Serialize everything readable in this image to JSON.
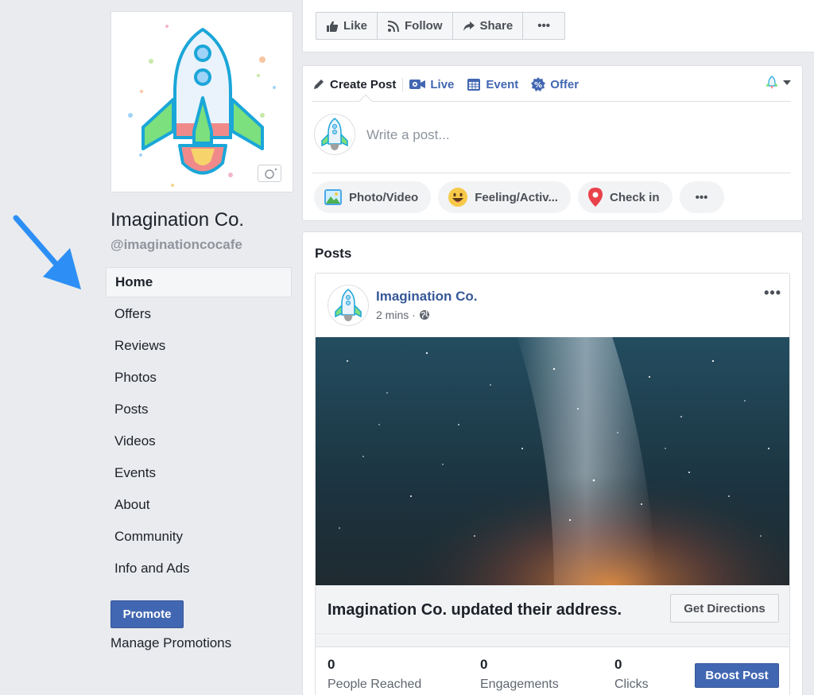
{
  "page": {
    "name": "Imagination Co.",
    "handle": "@imaginationcocafe"
  },
  "nav": {
    "items": [
      {
        "label": "Home"
      },
      {
        "label": "Offers"
      },
      {
        "label": "Reviews"
      },
      {
        "label": "Photos"
      },
      {
        "label": "Posts"
      },
      {
        "label": "Videos"
      },
      {
        "label": "Events"
      },
      {
        "label": "About"
      },
      {
        "label": "Community"
      },
      {
        "label": "Info and Ads"
      }
    ],
    "active": "Home"
  },
  "promote": {
    "button_label": "Promote",
    "manage_label": "Manage Promotions"
  },
  "actions": {
    "like": "Like",
    "follow": "Follow",
    "share": "Share",
    "more": "•••"
  },
  "composer": {
    "tabs": [
      "Create Post",
      "Live",
      "Event",
      "Offer"
    ],
    "placeholder": "Write a post...",
    "pills": [
      "Photo/Video",
      "Feeling/Activ...",
      "Check in"
    ],
    "more": "•••"
  },
  "posts": {
    "title": "Posts",
    "author": "Imagination Co.",
    "time": "2 mins ·",
    "more": "•••",
    "update_text": "Imagination Co. updated their address.",
    "directions_label": "Get Directions",
    "stats": [
      {
        "value": "0",
        "label": "People Reached"
      },
      {
        "value": "0",
        "label": "Engagements"
      },
      {
        "value": "0",
        "label": "Clicks"
      }
    ],
    "boost_label": "Boost Post"
  },
  "colors": {
    "brand_blue": "#4267b2",
    "link_blue": "#365899",
    "background": "#e9ebee",
    "arrow_blue": "#2d8ff5"
  }
}
